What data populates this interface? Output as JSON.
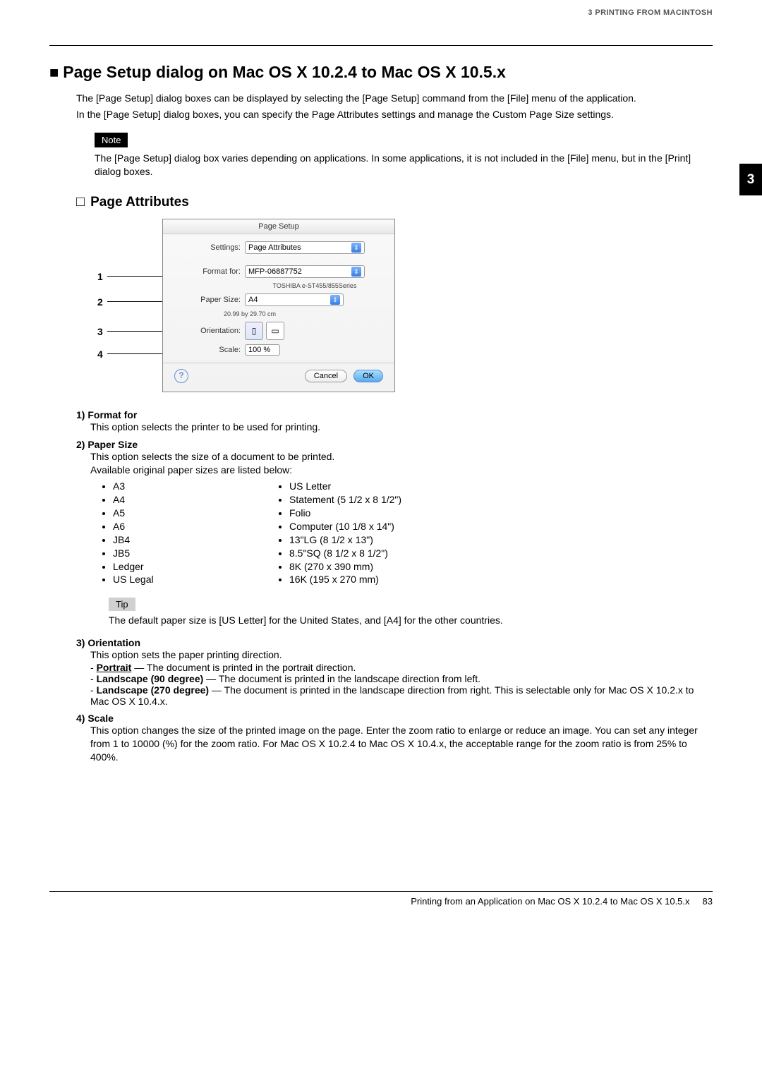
{
  "header": {
    "section": "3 PRINTING FROM MACINTOSH"
  },
  "chapter_tab": "3",
  "h1": "Page Setup dialog on Mac OS X 10.2.4 to Mac OS X 10.5.x",
  "intro1": "The [Page Setup] dialog boxes can be displayed by selecting the [Page Setup] command from the [File] menu of the application.",
  "intro2": "In the [Page Setup] dialog boxes, you can specify the Page Attributes settings and manage the Custom Page Size settings.",
  "note_label": "Note",
  "note_text": "The [Page Setup] dialog box varies depending on applications. In some applications, it is not included in the [File] menu, but in the [Print] dialog boxes.",
  "h2": "Page Attributes",
  "dialog": {
    "title": "Page Setup",
    "settings_label": "Settings:",
    "settings_value": "Page Attributes",
    "format_label": "Format for:",
    "format_value": "MFP-06887752",
    "format_sub": "TOSHIBA e-ST455/855Series",
    "paper_label": "Paper Size:",
    "paper_value": "A4",
    "paper_sub": "20.99 by 29.70 cm",
    "orient_label": "Orientation:",
    "scale_label": "Scale:",
    "scale_value": "100 %",
    "cancel": "Cancel",
    "ok": "OK"
  },
  "callouts": {
    "c1": "1",
    "c2": "2",
    "c3": "3",
    "c4": "4"
  },
  "items": {
    "format": {
      "head": "1)  Format for",
      "desc": "This option selects the printer to be used for printing."
    },
    "paper": {
      "head": "2)  Paper Size",
      "desc1": "This option selects the size of a document to be printed.",
      "desc2": "Available original paper sizes are listed below:",
      "col1": [
        "A3",
        "A4",
        "A5",
        "A6",
        "JB4",
        "JB5",
        "Ledger",
        "US Legal"
      ],
      "col2": [
        "US Letter",
        "Statement (5 1/2 x 8 1/2\")",
        "Folio",
        "Computer (10 1/8 x 14\")",
        "13\"LG (8 1/2 x 13\")",
        "8.5\"SQ (8 1/2 x 8 1/2\")",
        "8K (270 x 390 mm)",
        "16K (195 x 270 mm)"
      ]
    },
    "tip_label": "Tip",
    "tip_text": "The default paper size is [US Letter] for the United States, and [A4] for the other countries.",
    "orient": {
      "head": "3)  Orientation",
      "desc": "This option sets the paper printing direction.",
      "r1a": "Portrait",
      "r1b": " — The document is printed in the portrait direction.",
      "r2a": "Landscape (90 degree)",
      "r2b": " — The document is printed in the landscape direction from left.",
      "r3a": "Landscape (270 degree)",
      "r3b": " — The document is printed in the landscape direction from right. This is selectable only for Mac OS X 10.2.x to Mac OS X 10.4.x."
    },
    "scale": {
      "head": "4)  Scale",
      "desc": "This option changes the size of the printed image on the page. Enter the zoom ratio to enlarge or reduce an image. You can set any integer from 1 to 10000 (%) for the zoom ratio. For Mac OS X 10.2.4 to Mac OS X 10.4.x, the acceptable range for the zoom ratio is from 25% to 400%."
    }
  },
  "footer": {
    "text": "Printing from an Application on Mac OS X 10.2.4 to Mac OS X 10.5.x",
    "page": "83"
  }
}
